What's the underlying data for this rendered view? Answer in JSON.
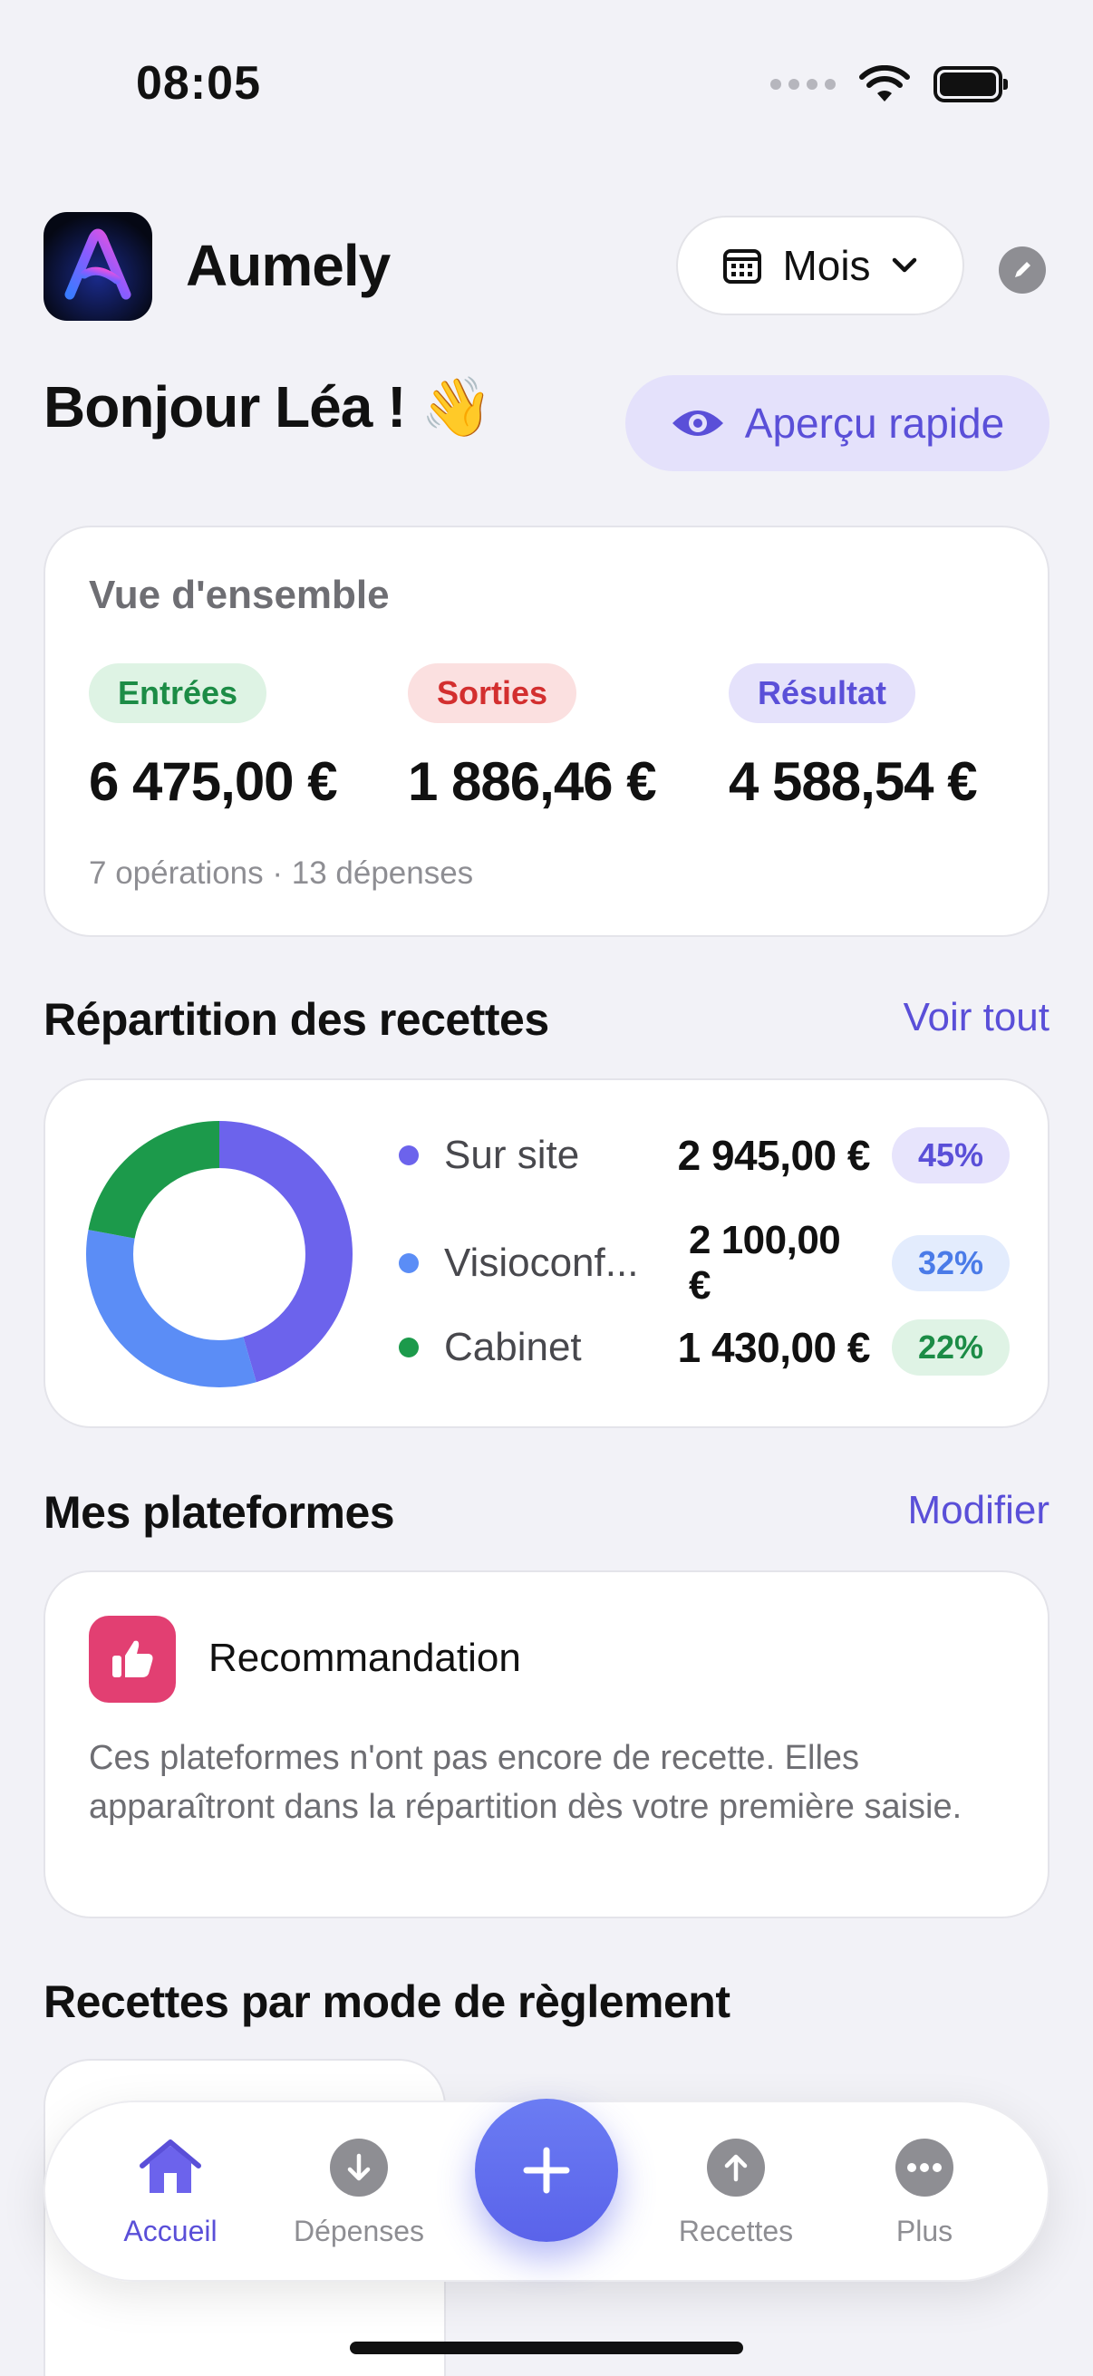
{
  "status": {
    "time": "08:05"
  },
  "header": {
    "app_name": "Aumely",
    "period_label": "Mois",
    "greeting": "Bonjour Léa ! 👋",
    "preview_label": "Aperçu rapide"
  },
  "overview": {
    "title": "Vue d'ensemble",
    "income_label": "Entrées",
    "income_value": "6 475,00 €",
    "expense_label": "Sorties",
    "expense_value": "1 886,46 €",
    "result_label": "Résultat",
    "result_value": "4 588,54 €",
    "meta": "7 opérations · 13 dépenses"
  },
  "revenue_split": {
    "title": "Répartition des recettes",
    "link": "Voir tout",
    "items": [
      {
        "label": "Sur site",
        "value": "2 945,00 €",
        "percent": "45%",
        "share": 45.5,
        "color": "#6c63ec",
        "pill_bg": "#e7e4fc",
        "pill_fg": "#5a4fd8"
      },
      {
        "label": "Visioconf...",
        "value": "2 100,00 €",
        "percent": "32%",
        "share": 32.4,
        "color": "#5b8df6",
        "pill_bg": "#e3ecfd",
        "pill_fg": "#4a7be8"
      },
      {
        "label": "Cabinet",
        "value": "1 430,00 €",
        "percent": "22%",
        "share": 22.1,
        "color": "#1c9a4b",
        "pill_bg": "#dff3e5",
        "pill_fg": "#1c8c46"
      }
    ]
  },
  "platforms": {
    "title": "Mes plateformes",
    "link": "Modifier",
    "card_title": "Recommandation",
    "card_desc": "Ces plateformes n'ont pas encore de recette. Elles apparaîtront dans la répartition dès votre première saisie."
  },
  "payment_section": {
    "title": "Recettes par mode de règlement"
  },
  "tabbar": {
    "home": "Accueil",
    "expenses": "Dépenses",
    "income": "Recettes",
    "more": "Plus"
  },
  "colors": {
    "accent": "#5a4fd8",
    "background": "#f2f2f7"
  }
}
